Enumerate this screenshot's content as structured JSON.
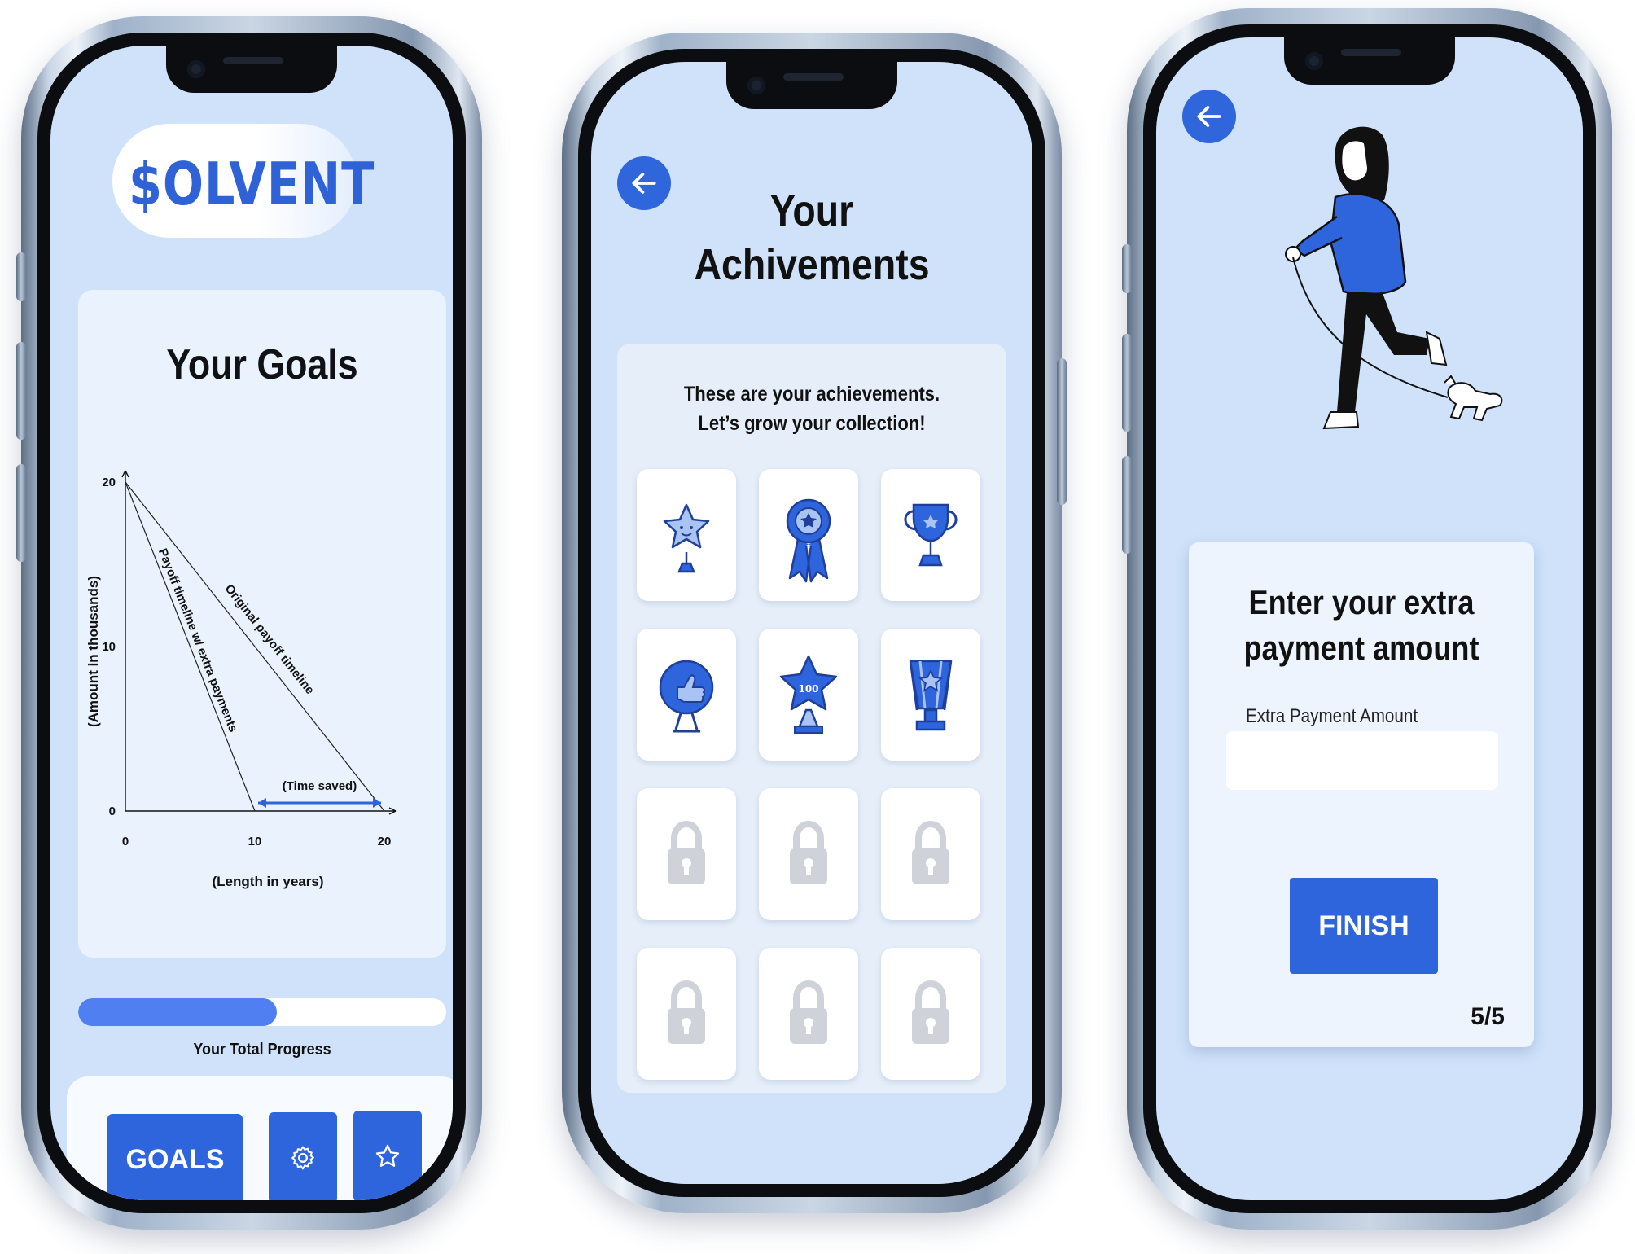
{
  "colors": {
    "primary": "#2f65dc",
    "screen_bg": "#cfe2fa",
    "card_bg": "#eaf2fd"
  },
  "goals_screen": {
    "logo": "$OLVENT",
    "title": "Your Goals",
    "progress_label": "Your Total Progress",
    "progress_fraction": 0.54,
    "nav": {
      "goals_label": "GOALS",
      "settings_icon": "gear-icon",
      "achievements_icon": "star-icon"
    }
  },
  "chart_data": {
    "type": "line",
    "title": "",
    "xlabel": "(Length in years)",
    "ylabel": "(Amount in thousands)",
    "x_ticks": [
      "0",
      "10",
      "20"
    ],
    "y_ticks": [
      "0",
      "10",
      "20"
    ],
    "xlim": [
      0,
      20
    ],
    "ylim": [
      0,
      20
    ],
    "series": [
      {
        "name": "Original payoff timeline",
        "x": [
          0,
          20
        ],
        "y": [
          20,
          0
        ]
      },
      {
        "name": "Payoff timeline w/ extra payments",
        "x": [
          0,
          10
        ],
        "y": [
          20,
          0
        ]
      }
    ],
    "annotation": "(Time saved)",
    "annotation_range": [
      10,
      20
    ]
  },
  "achievements_screen": {
    "back_icon": "arrow-left-icon",
    "title_line1": "Your",
    "title_line2": "Achivements",
    "intro_line1": "These are your achievements.",
    "intro_line2": "Let’s grow your collection!",
    "tiles": [
      {
        "icon": "smiling-star-trophy-icon",
        "unlocked": true
      },
      {
        "icon": "ribbon-badge-icon",
        "unlocked": true
      },
      {
        "icon": "cup-trophy-icon",
        "unlocked": true
      },
      {
        "icon": "thumbs-up-trophy-icon",
        "unlocked": true
      },
      {
        "icon": "star-100-trophy-icon",
        "unlocked": true
      },
      {
        "icon": "star-award-trophy-icon",
        "unlocked": true
      },
      {
        "icon": "lock-icon",
        "unlocked": false
      },
      {
        "icon": "lock-icon",
        "unlocked": false
      },
      {
        "icon": "lock-icon",
        "unlocked": false
      },
      {
        "icon": "lock-icon",
        "unlocked": false
      },
      {
        "icon": "lock-icon",
        "unlocked": false
      },
      {
        "icon": "lock-icon",
        "unlocked": false
      }
    ]
  },
  "payment_screen": {
    "back_icon": "arrow-left-icon",
    "title_line1": "Enter your extra",
    "title_line2": "payment amount",
    "field_label": "Extra Payment Amount",
    "field_value": "",
    "finish_label": "FINISH",
    "step": "5/5"
  }
}
